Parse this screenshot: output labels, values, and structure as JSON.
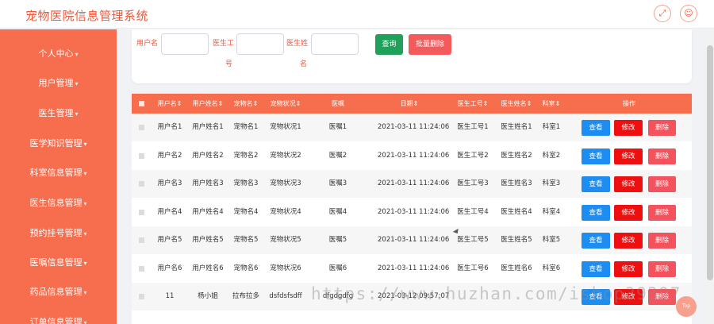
{
  "header": {
    "title": "宠物医院信息管理系统",
    "icons": [
      "fullscreen-icon",
      "user-icon"
    ]
  },
  "sidebar": {
    "items": [
      {
        "label": "个人中心"
      },
      {
        "label": "用户管理"
      },
      {
        "label": "医生管理"
      },
      {
        "label": "医学知识管理"
      },
      {
        "label": "科室信息管理"
      },
      {
        "label": "医生信息管理"
      },
      {
        "label": "预约挂号管理"
      },
      {
        "label": "医嘱信息管理"
      },
      {
        "label": "药品信息管理"
      },
      {
        "label": "订单信息管理"
      }
    ]
  },
  "search": {
    "field1_label": "用户名",
    "field2_label_a": "医生工",
    "field2_label_b": "号",
    "field3_label_a": "医生姓",
    "field3_label_b": "名",
    "search_button": "查询",
    "batch_delete_button": "批量删除"
  },
  "table": {
    "columns": [
      "用户名",
      "用户姓名",
      "宠物名",
      "宠物状况",
      "医嘱",
      "日期",
      "医生工号",
      "医生姓名",
      "科室",
      "操作"
    ],
    "rows": [
      {
        "username": "用户名1",
        "realname": "用户姓名1",
        "petname": "宠物名1",
        "petstatus": "宠物状况1",
        "advice": "医嘱1",
        "date": "2021-03-11 11:24:06",
        "docid": "医生工号1",
        "docname": "医生姓名1",
        "dept": "科室1"
      },
      {
        "username": "用户名2",
        "realname": "用户姓名2",
        "petname": "宠物名2",
        "petstatus": "宠物状况2",
        "advice": "医嘱2",
        "date": "2021-03-11 11:24:06",
        "docid": "医生工号2",
        "docname": "医生姓名2",
        "dept": "科室2"
      },
      {
        "username": "用户名3",
        "realname": "用户姓名3",
        "petname": "宠物名3",
        "petstatus": "宠物状况3",
        "advice": "医嘱3",
        "date": "2021-03-11 11:24:06",
        "docid": "医生工号3",
        "docname": "医生姓名3",
        "dept": "科室3"
      },
      {
        "username": "用户名4",
        "realname": "用户姓名4",
        "petname": "宠物名4",
        "petstatus": "宠物状况4",
        "advice": "医嘱4",
        "date": "2021-03-11 11:24:06",
        "docid": "医生工号4",
        "docname": "医生姓名4",
        "dept": "科室4"
      },
      {
        "username": "用户名5",
        "realname": "用户姓名5",
        "petname": "宠物名5",
        "petstatus": "宠物状况5",
        "advice": "医嘱5",
        "date": "2021-03-11 11:24:06",
        "docid": "医生工号5",
        "docname": "医生姓名5",
        "dept": "科室5"
      },
      {
        "username": "用户名6",
        "realname": "用户姓名6",
        "petname": "宠物名6",
        "petstatus": "宠物状况6",
        "advice": "医嘱6",
        "date": "2021-03-11 11:24:06",
        "docid": "医生工号6",
        "docname": "医生姓名6",
        "dept": "科室6"
      },
      {
        "username": "11",
        "realname": "杨小姐",
        "petname": "拉布拉多",
        "petstatus": "dsfdsfsdff",
        "advice": "dfgdgdfg",
        "date": "2021-03-12 09:57:07",
        "docid": "",
        "docname": "",
        "dept": ""
      }
    ],
    "actions": {
      "view": "查看",
      "edit": "修改",
      "delete": "删除"
    }
  },
  "to_top_label": "Top",
  "watermark": "https://www.huzhan.com/ishop39397",
  "colors": {
    "accent": "#f76e4f",
    "title": "#f0573a",
    "view": "#1e8df2",
    "edit": "#ee1010",
    "delete": "#f4525d",
    "search": "#1fa15b"
  }
}
